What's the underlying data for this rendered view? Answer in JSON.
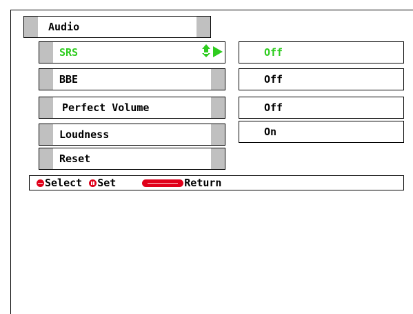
{
  "menu": {
    "title": "Audio",
    "items": [
      {
        "label": "SRS",
        "value": "Off",
        "selected": true
      },
      {
        "label": "BBE",
        "value": "Off",
        "selected": false
      },
      {
        "label": "Perfect Volume",
        "value": "Off",
        "selected": false
      },
      {
        "label": "Loudness",
        "value": "On",
        "selected": false
      },
      {
        "label": "Reset",
        "selected": false
      }
    ]
  },
  "help": {
    "select_label": "Select",
    "set_label": "Set",
    "return_label": "Return"
  },
  "colors": {
    "highlight": "#2ecc1f",
    "remote_button": "#e0001a",
    "bar_cap": "#c0c0c0"
  },
  "icons": [
    "up-down-arrow-icon",
    "right-triangle-icon",
    "select-button-icon",
    "set-button-icon",
    "return-button-icon"
  ]
}
